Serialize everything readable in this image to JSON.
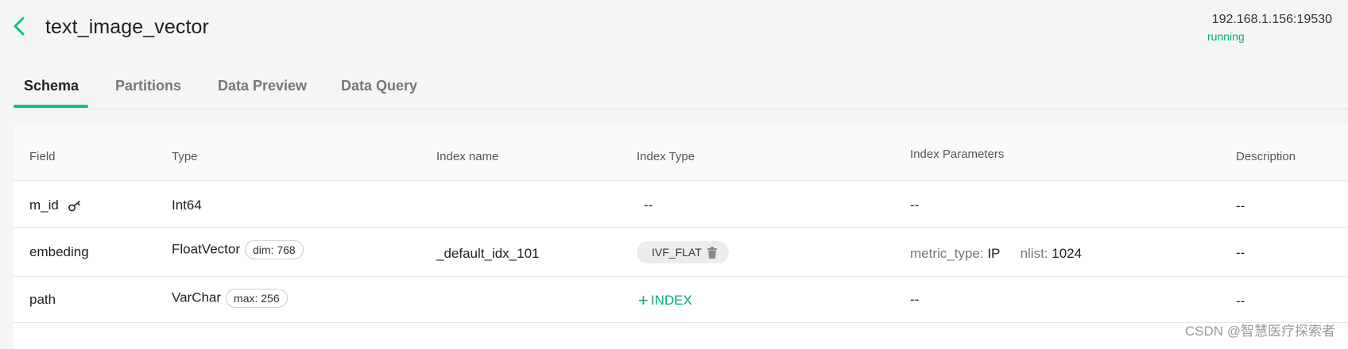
{
  "header": {
    "title": "text_image_vector",
    "address": "192.168.1.156:19530",
    "status": "running"
  },
  "tabs": [
    {
      "label": "Schema",
      "active": true
    },
    {
      "label": "Partitions",
      "active": false
    },
    {
      "label": "Data Preview",
      "active": false
    },
    {
      "label": "Data Query",
      "active": false
    }
  ],
  "table": {
    "columns": [
      "Field",
      "Type",
      "Index name",
      "Index Type",
      "Index Parameters",
      "Description"
    ],
    "rows": [
      {
        "field": "m_id",
        "is_primary_key": true,
        "type": "Int64",
        "type_param": "",
        "index_name": "",
        "index_type": "--",
        "index_params": "--",
        "description": "--"
      },
      {
        "field": "embeding",
        "is_primary_key": false,
        "type": "FloatVector",
        "type_param": "dim: 768",
        "index_name": "_default_idx_101",
        "index_type": "IVF_FLAT",
        "index_params": [
          {
            "key": "metric_type:",
            "value": "IP"
          },
          {
            "key": "nlist:",
            "value": "1024"
          }
        ],
        "description": "--"
      },
      {
        "field": "path",
        "is_primary_key": false,
        "type": "VarChar",
        "type_param": "max: 256",
        "index_name": "",
        "index_action": "INDEX",
        "index_params": "--",
        "description": "--"
      }
    ]
  },
  "watermark": "CSDN @智慧医疗探索者",
  "icons": {
    "back": "chevron-left-icon",
    "primary_key": "key-icon",
    "delete": "trash-icon",
    "add": "plus-icon"
  },
  "colors": {
    "accent": "#06c47b",
    "status": "#06b06c"
  }
}
